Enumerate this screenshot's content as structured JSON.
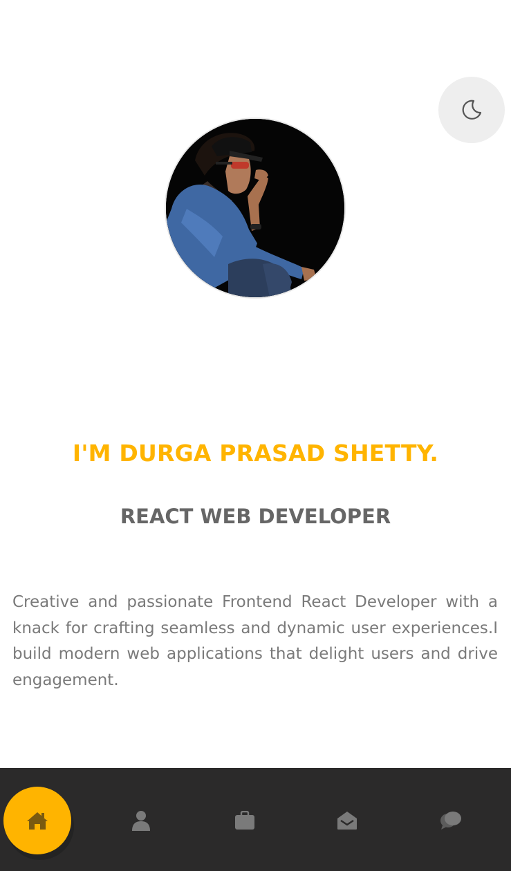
{
  "hero": {
    "name": "I'M DURGA PRASAD SHETTY.",
    "role": "REACT WEB DEVELOPER",
    "bio": "Creative and passionate Frontend React Developer with a knack for crafting seamless and dynamic user experiences.I build modern web applications that delight users and drive engagement."
  },
  "icons": {
    "theme_toggle": "moon-icon",
    "nav": [
      "home-icon",
      "user-icon",
      "briefcase-icon",
      "envelope-open-icon",
      "comments-icon"
    ]
  },
  "colors": {
    "accent": "#ffb400",
    "role_text": "#666666",
    "bio_text": "#7a7a7a",
    "nav_background": "#2b2a2a",
    "nav_icon": "#7a7a7a",
    "toggle_background": "#eeeeee"
  }
}
